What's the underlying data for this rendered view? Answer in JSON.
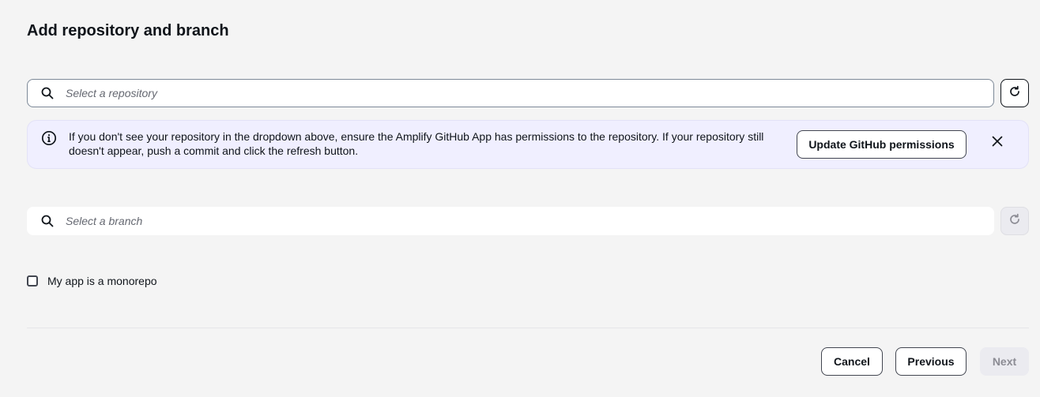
{
  "page": {
    "title": "Add repository and branch"
  },
  "repository": {
    "placeholder": "Select a repository",
    "refresh_icon": "refresh-icon"
  },
  "alert": {
    "message": "If you don't see your repository in the dropdown above, ensure the Amplify GitHub App has permissions to the repository. If your repository still doesn't appear, push a commit and click the refresh button.",
    "button_label": "Update GitHub permissions",
    "icon": "info-icon",
    "background": "#f0efff"
  },
  "branch": {
    "placeholder": "Select a branch",
    "refresh_icon": "refresh-icon"
  },
  "monorepo": {
    "label": "My app is a monorepo",
    "checked": false
  },
  "footer": {
    "cancel_label": "Cancel",
    "previous_label": "Previous",
    "next_label": "Next"
  },
  "colors": {
    "background": "#f4f4f4",
    "text": "#0f141a",
    "disabled_button": "#ebebf0"
  }
}
